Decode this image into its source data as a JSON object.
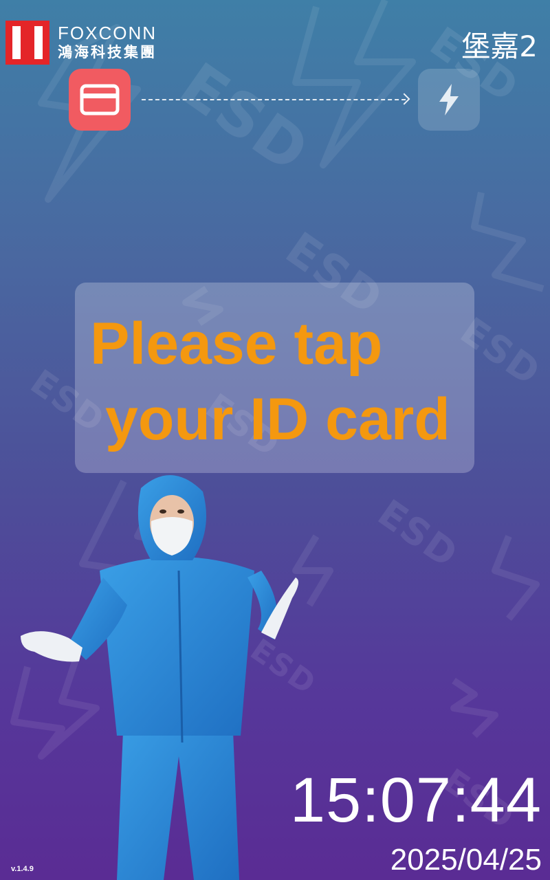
{
  "header": {
    "brand_name": "FOXCONN",
    "brand_chinese": "鴻海科技集團",
    "location": "堡嘉2"
  },
  "steps": {
    "current_icon": "card-icon",
    "next_icon": "bolt-icon"
  },
  "prompt": {
    "line1": "Please tap",
    "line2": "your ID card"
  },
  "watermark_text": "ESD",
  "status": {
    "time": "15:07:44",
    "date": "2025/04/25",
    "version": "v.1.4.9"
  },
  "colors": {
    "brand_red": "#e42528",
    "card_step": "#f15b61",
    "prompt_text": "#f4980f"
  }
}
